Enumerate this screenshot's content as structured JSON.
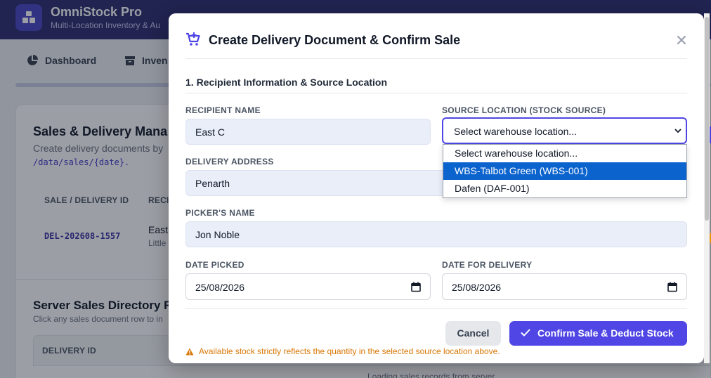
{
  "app": {
    "title": "OmniStock Pro",
    "subtitle": "Multi-Location Inventory & Au"
  },
  "nav": {
    "items": [
      {
        "label": "Dashboard",
        "icon": "pie-chart-icon"
      },
      {
        "label": "Inven",
        "icon": "box-icon"
      }
    ]
  },
  "background": {
    "sales_title": "Sales & Delivery Mana",
    "sales_desc": "Create delivery documents by",
    "sales_path": "/data/sales/{date}.",
    "table_headers": [
      "SALE / DELIVERY ID",
      "RECIP"
    ],
    "rows": [
      {
        "id": "DEL-202608-1557",
        "recipient": "East",
        "sub": "Little"
      }
    ],
    "directory_title": "Server Sales Directory Re",
    "directory_desc": "Click any sales document row to in",
    "directory_header": "DELIVERY ID",
    "loading_text": "Loading sales records from server..."
  },
  "modal": {
    "title": "Create Delivery Document & Confirm Sale",
    "section_title": "1. Recipient Information & Source Location",
    "fields": {
      "recipient_name": {
        "label": "RECIPIENT NAME",
        "value": "East C"
      },
      "source_location": {
        "label": "SOURCE LOCATION (STOCK SOURCE)",
        "value": "Select warehouse location...",
        "options": [
          "Select warehouse location...",
          "WBS-Talbot Green (WBS-001)",
          "Dafen (DAF-001)"
        ],
        "highlighted_option": "WBS-Talbot Green (WBS-001)"
      },
      "delivery_address": {
        "label": "DELIVERY ADDRESS",
        "value": "Penarth"
      },
      "picker_name": {
        "label": "PICKER'S NAME",
        "value": "Jon Noble"
      },
      "date_picked": {
        "label": "DATE PICKED",
        "value": "25/08/2026"
      },
      "date_delivery": {
        "label": "DATE FOR DELIVERY",
        "value": "25/08/2026"
      }
    },
    "buttons": {
      "cancel": "Cancel",
      "confirm": "Confirm Sale & Deduct Stock"
    },
    "warning": "Available stock strictly reflects the quantity in the selected source location above."
  },
  "colors": {
    "brand": "#2d2b6f",
    "accent": "#4f46e5",
    "warning": "#d97706",
    "selected_option": "#0b63ce"
  }
}
